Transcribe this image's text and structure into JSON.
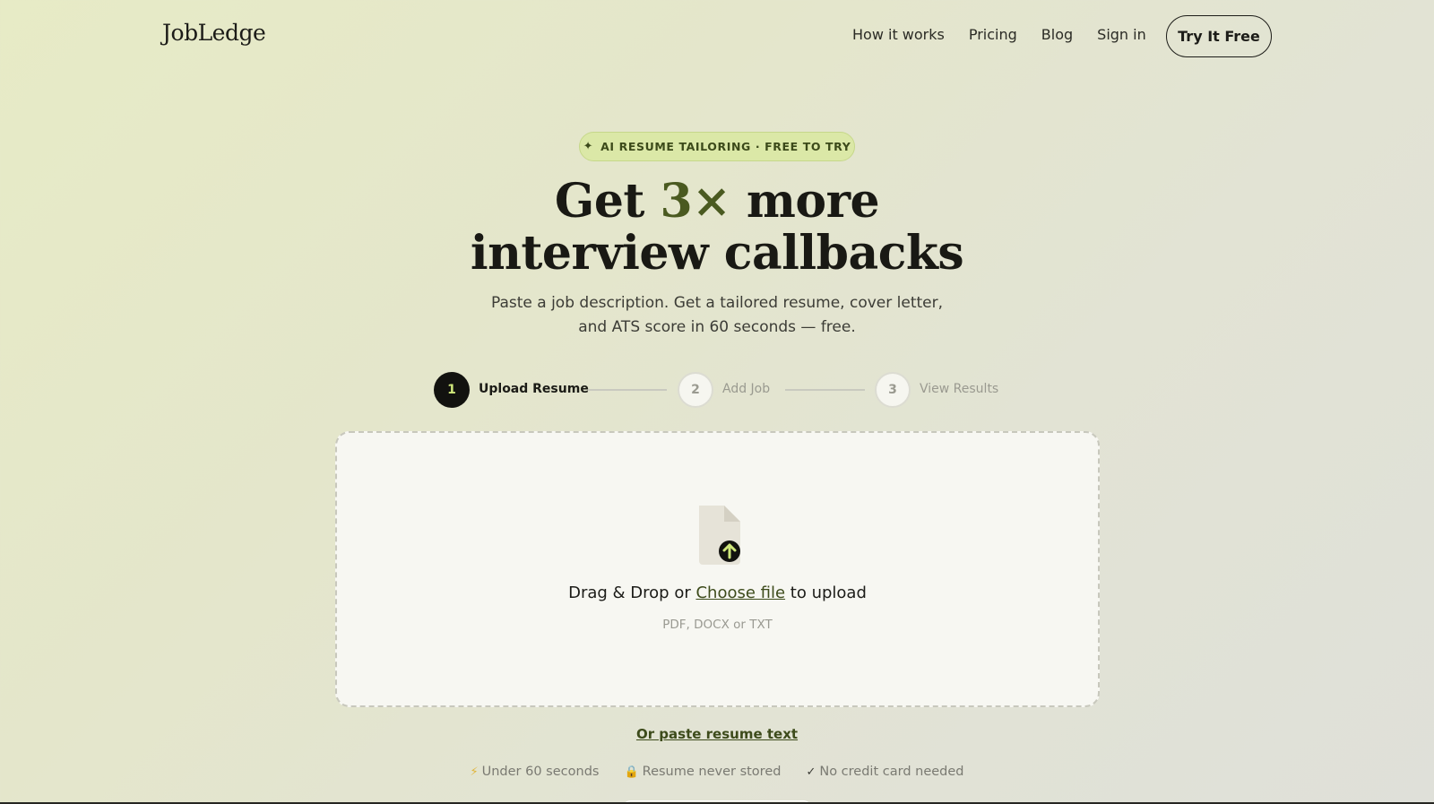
{
  "header": {
    "logo": "JobLedge",
    "nav": [
      "How it works",
      "Pricing",
      "Blog",
      "Sign in"
    ],
    "cta_label": "Try It Free"
  },
  "hero": {
    "badge_icon": "sparkle-icon",
    "badge": "AI RESUME TAILORING · FREE TO TRY",
    "headline_pre": "Get ",
    "headline_accent": "3×",
    "headline_post": " more",
    "headline_line2": "interview callbacks",
    "subhead_line1": "Paste a job description. Get a tailored resume, cover letter,",
    "subhead_line2": "and ATS score in 60 seconds — free."
  },
  "steps": [
    {
      "number": "1",
      "label": "Upload Resume",
      "state": "active"
    },
    {
      "number": "2",
      "label": "Add Job",
      "state": "idle"
    },
    {
      "number": "3",
      "label": "View Results",
      "state": "idle"
    }
  ],
  "upload": {
    "icon": "file-upload-icon",
    "prefix": "Drag & Drop or ",
    "link": "Choose file",
    "suffix": " to upload",
    "formats": "PDF, DOCX or TXT"
  },
  "paste_link": "Or paste resume text",
  "trust": [
    {
      "icon": "lightning-icon",
      "glyph": "⚡",
      "text": "Under 60 seconds"
    },
    {
      "icon": "lock-icon",
      "glyph": "🔒",
      "text": "Resume never stored"
    },
    {
      "icon": "check-icon",
      "glyph": "✓",
      "text": "No credit card needed"
    }
  ],
  "colors": {
    "accent": "#cfe77a",
    "accent_dark": "#3d4b1b",
    "text": "#1b1b16",
    "badge_bg": "#dbe8a7"
  }
}
